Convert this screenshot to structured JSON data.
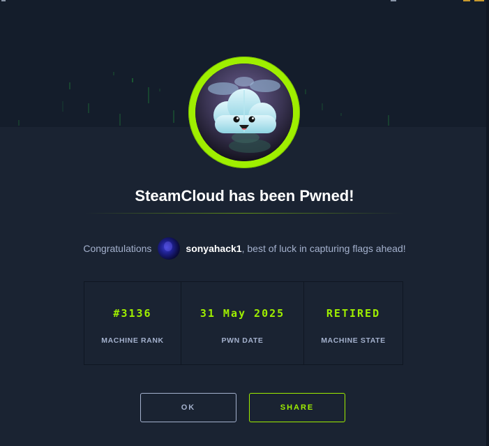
{
  "machine": {
    "title": "SteamCloud has been Pwned!"
  },
  "congrats": {
    "prefix": "Congratulations",
    "username": "sonyahack1",
    "suffix": ", best of luck in capturing flags ahead!"
  },
  "stats": [
    {
      "value": "#3136",
      "label": "MACHINE RANK"
    },
    {
      "value": "31 May 2025",
      "label": "PWN DATE"
    },
    {
      "value": "RETIRED",
      "label": "MACHINE STATE"
    }
  ],
  "buttons": {
    "ok_label": "OK",
    "share_label": "SHARE"
  },
  "icons": {
    "machine_avatar": "cloud-mascot-icon",
    "user_avatar": "user-avatar"
  },
  "colors": {
    "accent": "#9fef00",
    "background": "#1a2332",
    "background_top": "#141d2b",
    "muted_text": "#a4b1cd"
  }
}
